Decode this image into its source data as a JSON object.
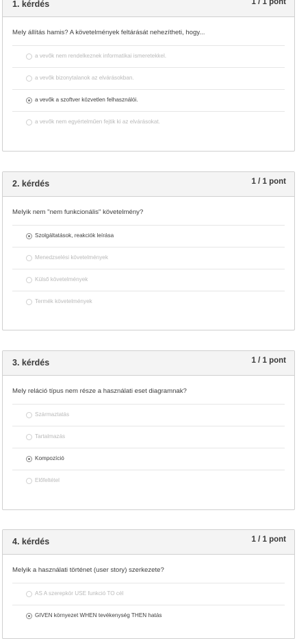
{
  "questions": [
    {
      "title": "1. kérdés",
      "points": "1 / 1 pont",
      "text": "Mely állítás hamis? A követelmények feltárását nehezítheti, hogy...",
      "options": [
        {
          "label": "a vevők nem rendelkeznek informatikai ismeretekkel.",
          "selected": false
        },
        {
          "label": "a vevők bizonytalanok az elvárásokban.",
          "selected": false
        },
        {
          "label": "a vevők a szoftver közvetlen felhasználói.",
          "selected": true
        },
        {
          "label": "a vevők nem egyértelműen fejtik ki az elvárásokat.",
          "selected": false
        }
      ]
    },
    {
      "title": "2. kérdés",
      "points": "1 / 1 pont",
      "text": "Melyik nem \"nem funkcionális\" követelmény?",
      "options": [
        {
          "label": "Szolgáltatások, reakciók leírása",
          "selected": true
        },
        {
          "label": "Menedzselési követelmények",
          "selected": false
        },
        {
          "label": "Külső követelmények",
          "selected": false
        },
        {
          "label": "Termék követelmények",
          "selected": false
        }
      ]
    },
    {
      "title": "3. kérdés",
      "points": "1 / 1 pont",
      "text": "Mely reláció típus nem része a használati eset diagramnak?",
      "options": [
        {
          "label": "Származtatás",
          "selected": false
        },
        {
          "label": "Tartalmazás",
          "selected": false
        },
        {
          "label": "Kompozíció",
          "selected": true
        },
        {
          "label": "Előfeltétel",
          "selected": false
        }
      ]
    },
    {
      "title": "4. kérdés",
      "points": "1 / 1 pont",
      "text": "Melyik a használati történet (user story) szerkezete?",
      "options": [
        {
          "label": "AS A szerepkör USE funkció TO cél",
          "selected": false
        },
        {
          "label": "GIVEN környezet WHEN tevékenység THEN hatás",
          "selected": true
        }
      ]
    }
  ]
}
